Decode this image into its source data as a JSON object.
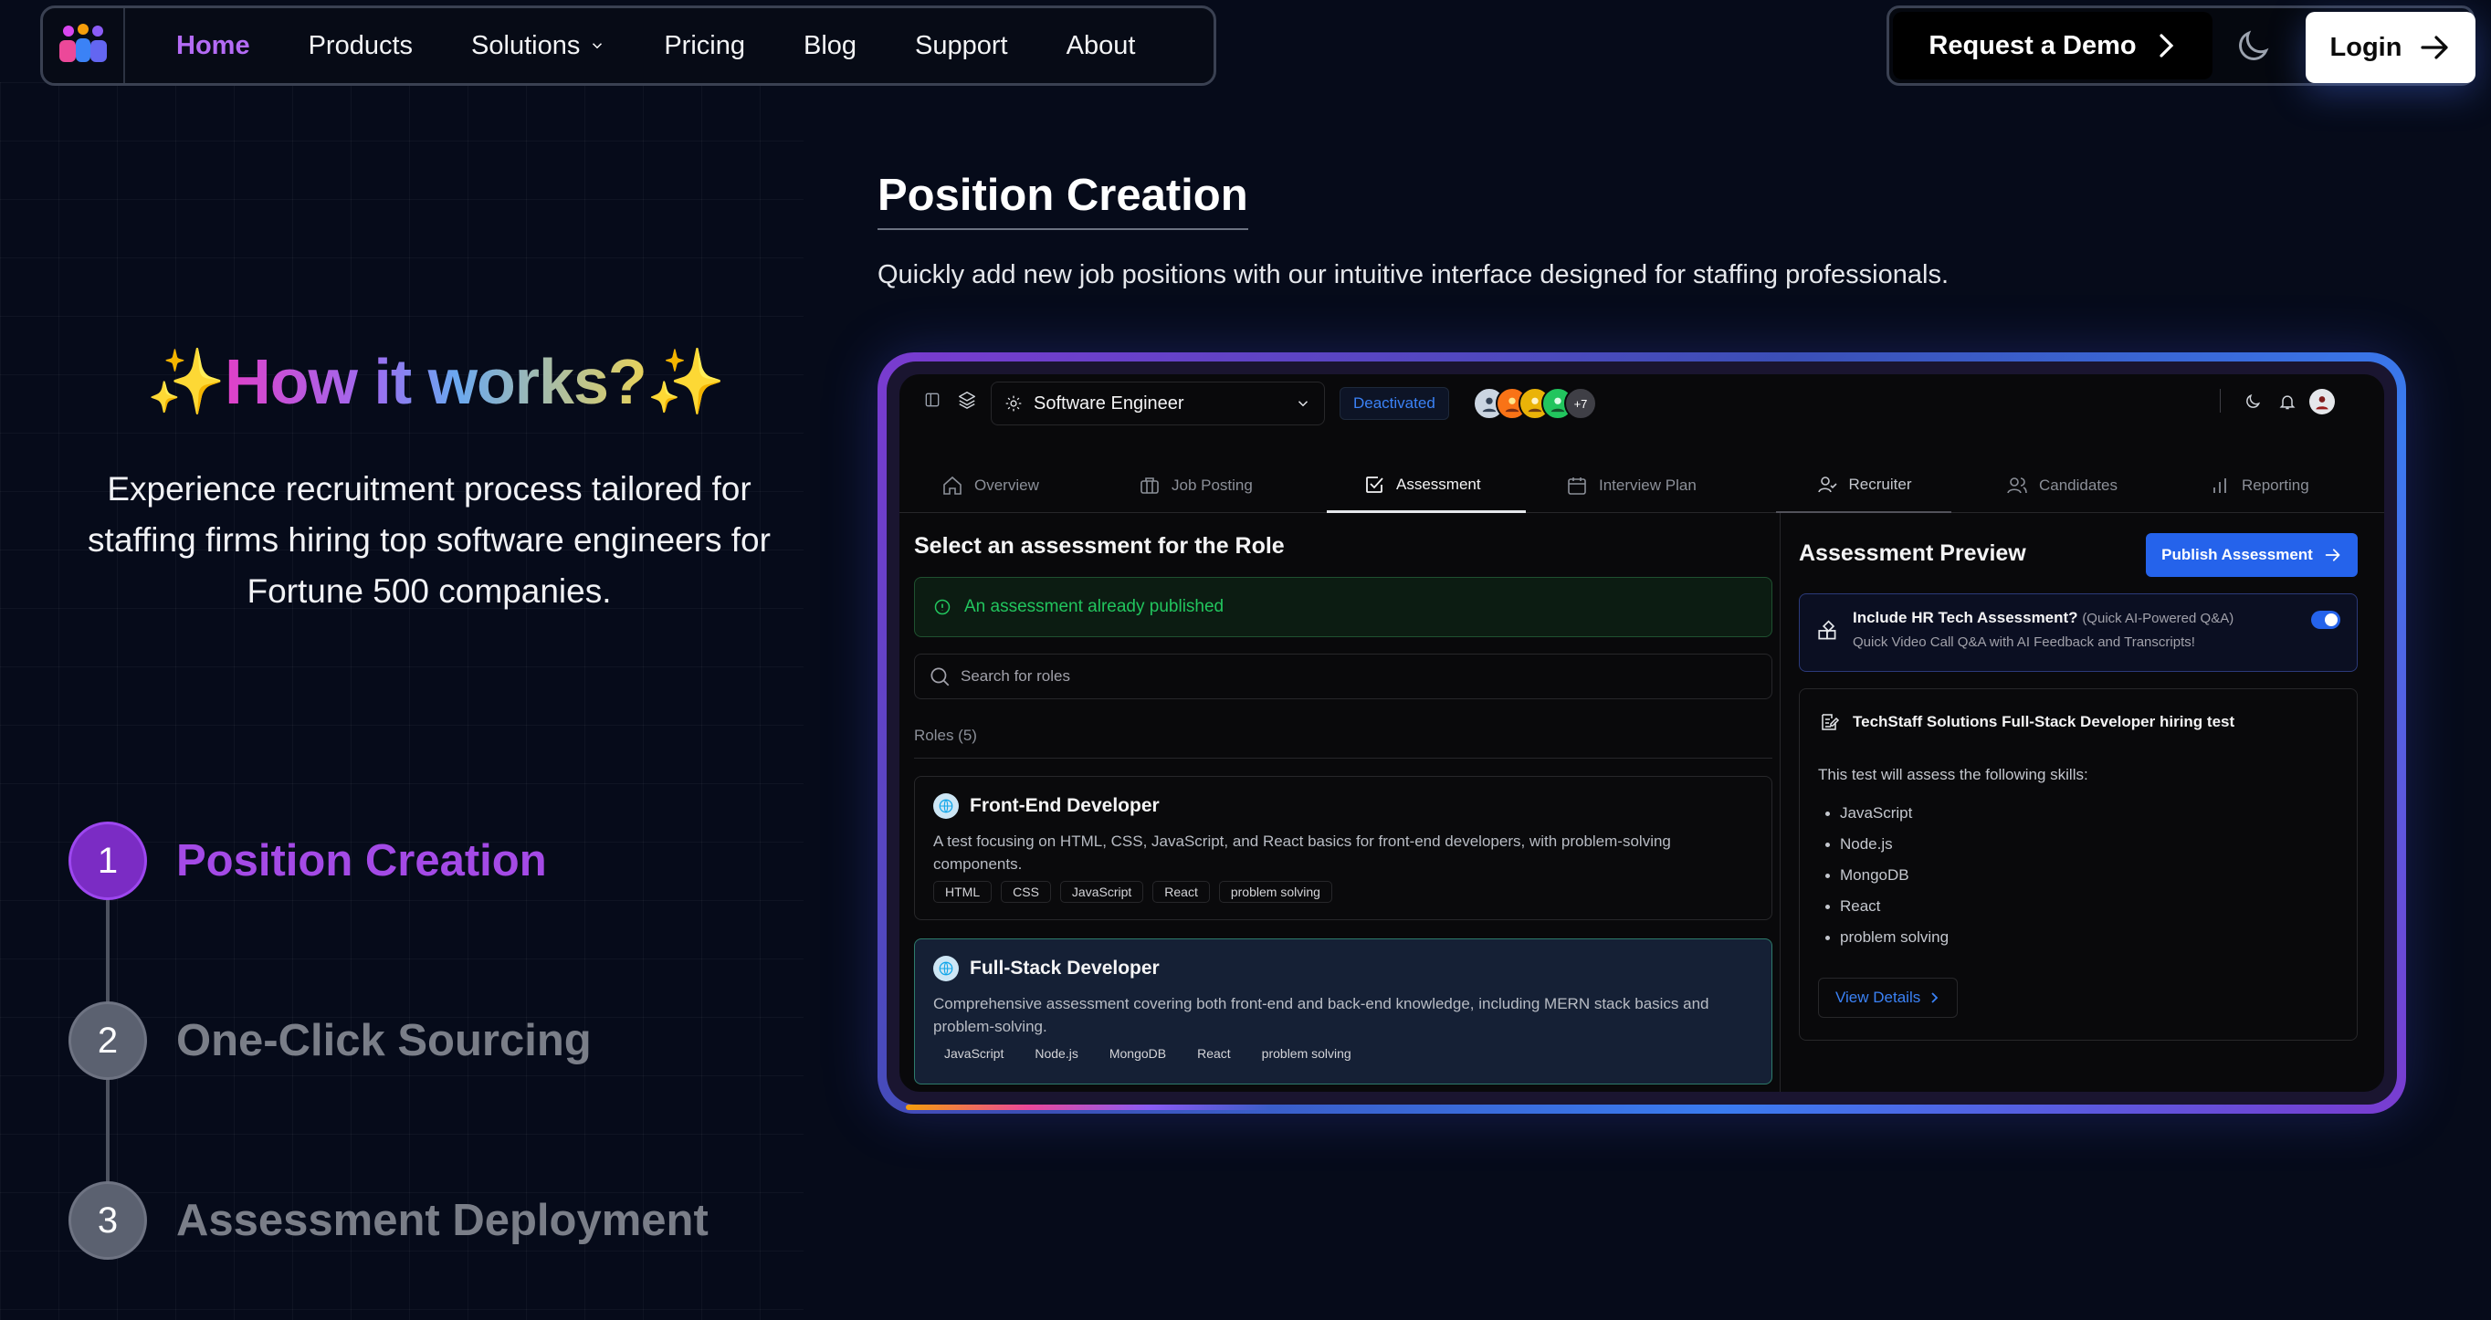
{
  "nav": {
    "items": [
      "Home",
      "Products",
      "Solutions",
      "Pricing",
      "Blog",
      "Support",
      "About"
    ],
    "active": "Home",
    "demo_label": "Request a Demo",
    "login_label": "Login"
  },
  "left": {
    "hiw_spark": "✨",
    "hiw_title": "How it works?",
    "intro": "Experience recruitment process tailored for staffing firms hiring top software engineers for Fortune 500 companies.",
    "steps": [
      {
        "num": "1",
        "label": "Position Creation"
      },
      {
        "num": "2",
        "label": "One-Click Sourcing"
      },
      {
        "num": "3",
        "label": "Assessment Deployment"
      }
    ]
  },
  "section": {
    "title": "Position Creation",
    "subtitle": "Quickly add new job positions with our intuitive interface designed for staffing professionals."
  },
  "app": {
    "role_select": "Software Engineer",
    "status_badge": "Deactivated",
    "avatar_more": "+7",
    "tabs": [
      "Overview",
      "Job Posting",
      "Assessment",
      "Interview Plan",
      "Recruiter",
      "Candidates",
      "Reporting"
    ],
    "active_tab": "Assessment",
    "left_title": "Select an assessment for the Role",
    "alert": "An assessment already published",
    "search_placeholder": "Search for roles",
    "roles_count": "Roles (5)",
    "roles": [
      {
        "title": "Front-End Developer",
        "desc": "A test focusing on HTML, CSS, JavaScript, and React basics for front-end developers, with problem-solving components.",
        "tags": [
          "HTML",
          "CSS",
          "JavaScript",
          "React",
          "problem solving"
        ]
      },
      {
        "title": "Full-Stack Developer",
        "desc": "Comprehensive assessment covering both front-end and back-end knowledge, including MERN stack basics and problem-solving.",
        "tags": [
          "JavaScript",
          "Node.js",
          "MongoDB",
          "React",
          "problem solving"
        ]
      }
    ],
    "preview_title": "Assessment Preview",
    "publish_label": "Publish Assessment",
    "hr_title": "Include HR Tech Assessment?",
    "hr_title_small": "(Quick AI-Powered Q&A)",
    "hr_sub": "Quick Video Call Q&A with AI Feedback and Transcripts!",
    "hr_toggle_on": true,
    "test_title": "TechStaff Solutions Full-Stack Developer hiring test",
    "test_desc": "This test will assess the following skills:",
    "skills": [
      "JavaScript",
      "Node.js",
      "MongoDB",
      "React",
      "problem solving"
    ],
    "view_details": "View Details"
  },
  "colors": {
    "accent_purple": "#a44ae6",
    "primary_blue": "#2563eb",
    "success_green": "#22c55e"
  }
}
